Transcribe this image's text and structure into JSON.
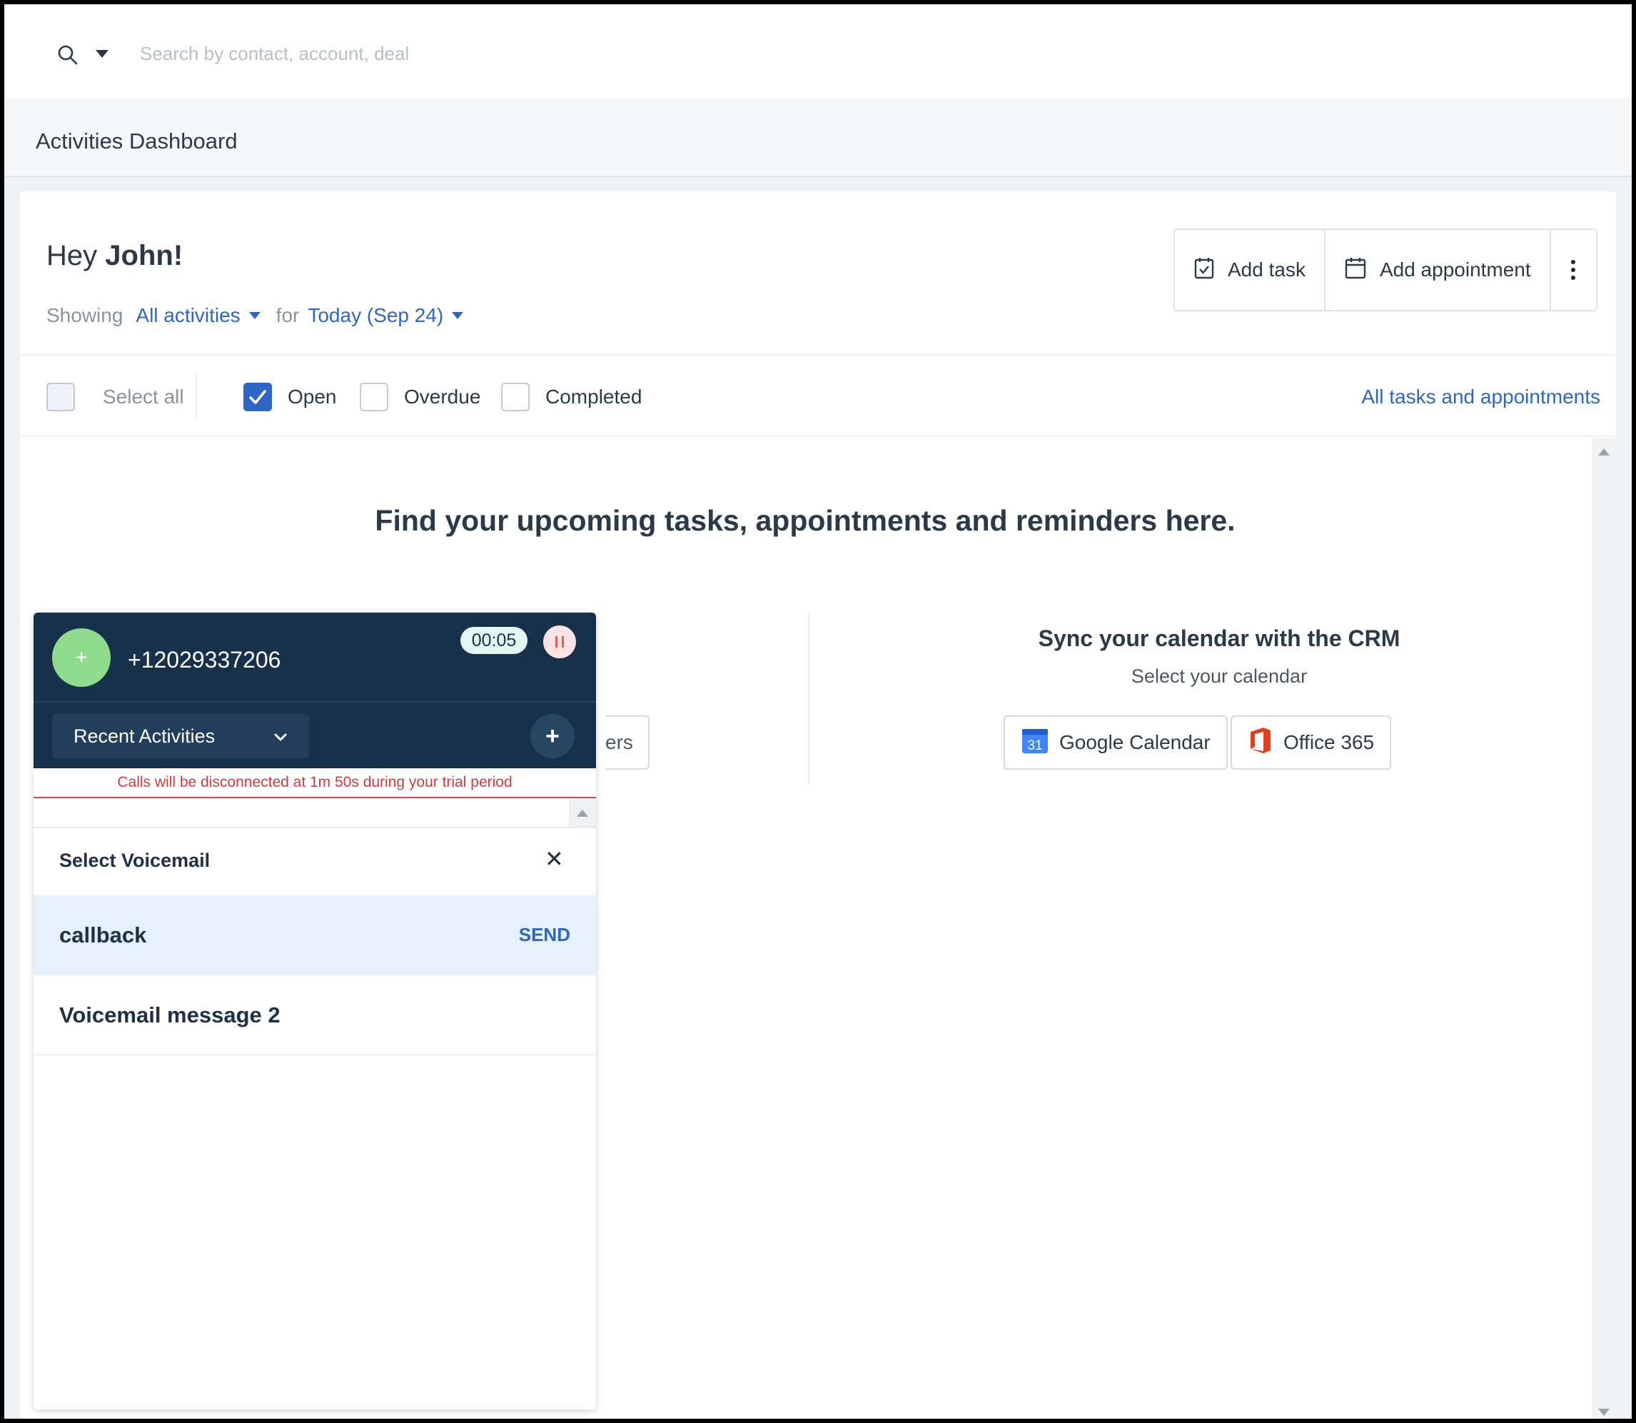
{
  "search": {
    "placeholder": "Search by contact, account, deal"
  },
  "page": {
    "title": "Activities Dashboard"
  },
  "greeting": {
    "prefix": "Hey",
    "name": "John!"
  },
  "actions": {
    "add_task": "Add task",
    "add_appointment": "Add appointment"
  },
  "showing": {
    "label": "Showing",
    "activity_filter": "All activities",
    "for_label": "for",
    "date_filter": "Today (Sep 24)"
  },
  "filters": {
    "select_all": "Select all",
    "open": "Open",
    "overdue": "Overdue",
    "completed": "Completed",
    "all_link": "All tasks and appointments",
    "open_checked": true
  },
  "empty_state": {
    "headline": "Find your upcoming tasks, appointments and reminders here."
  },
  "calendar_sync": {
    "title": "Sync your calendar with the CRM",
    "subtitle": "Select your calendar",
    "google": "Google Calendar",
    "google_icon_text": "31",
    "office": "Office 365",
    "partial_button_text": "ers"
  },
  "phone": {
    "number": "+12029337206",
    "timer": "00:05",
    "avatar_symbol": "+",
    "recent_label": "Recent Activities",
    "add_symbol": "+",
    "trial_warning": "Calls will be disconnected at 1m 50s during your trial period",
    "voicemail": {
      "title": "Select Voicemail",
      "close_symbol": "✕",
      "items": [
        {
          "name": "callback",
          "action": "SEND"
        },
        {
          "name": "Voicemail message 2"
        }
      ]
    }
  },
  "colors": {
    "accent": "#2d66c4",
    "phone_header": "#17314a",
    "warning": "#d43a41",
    "selected_row": "#e6f0fb"
  }
}
